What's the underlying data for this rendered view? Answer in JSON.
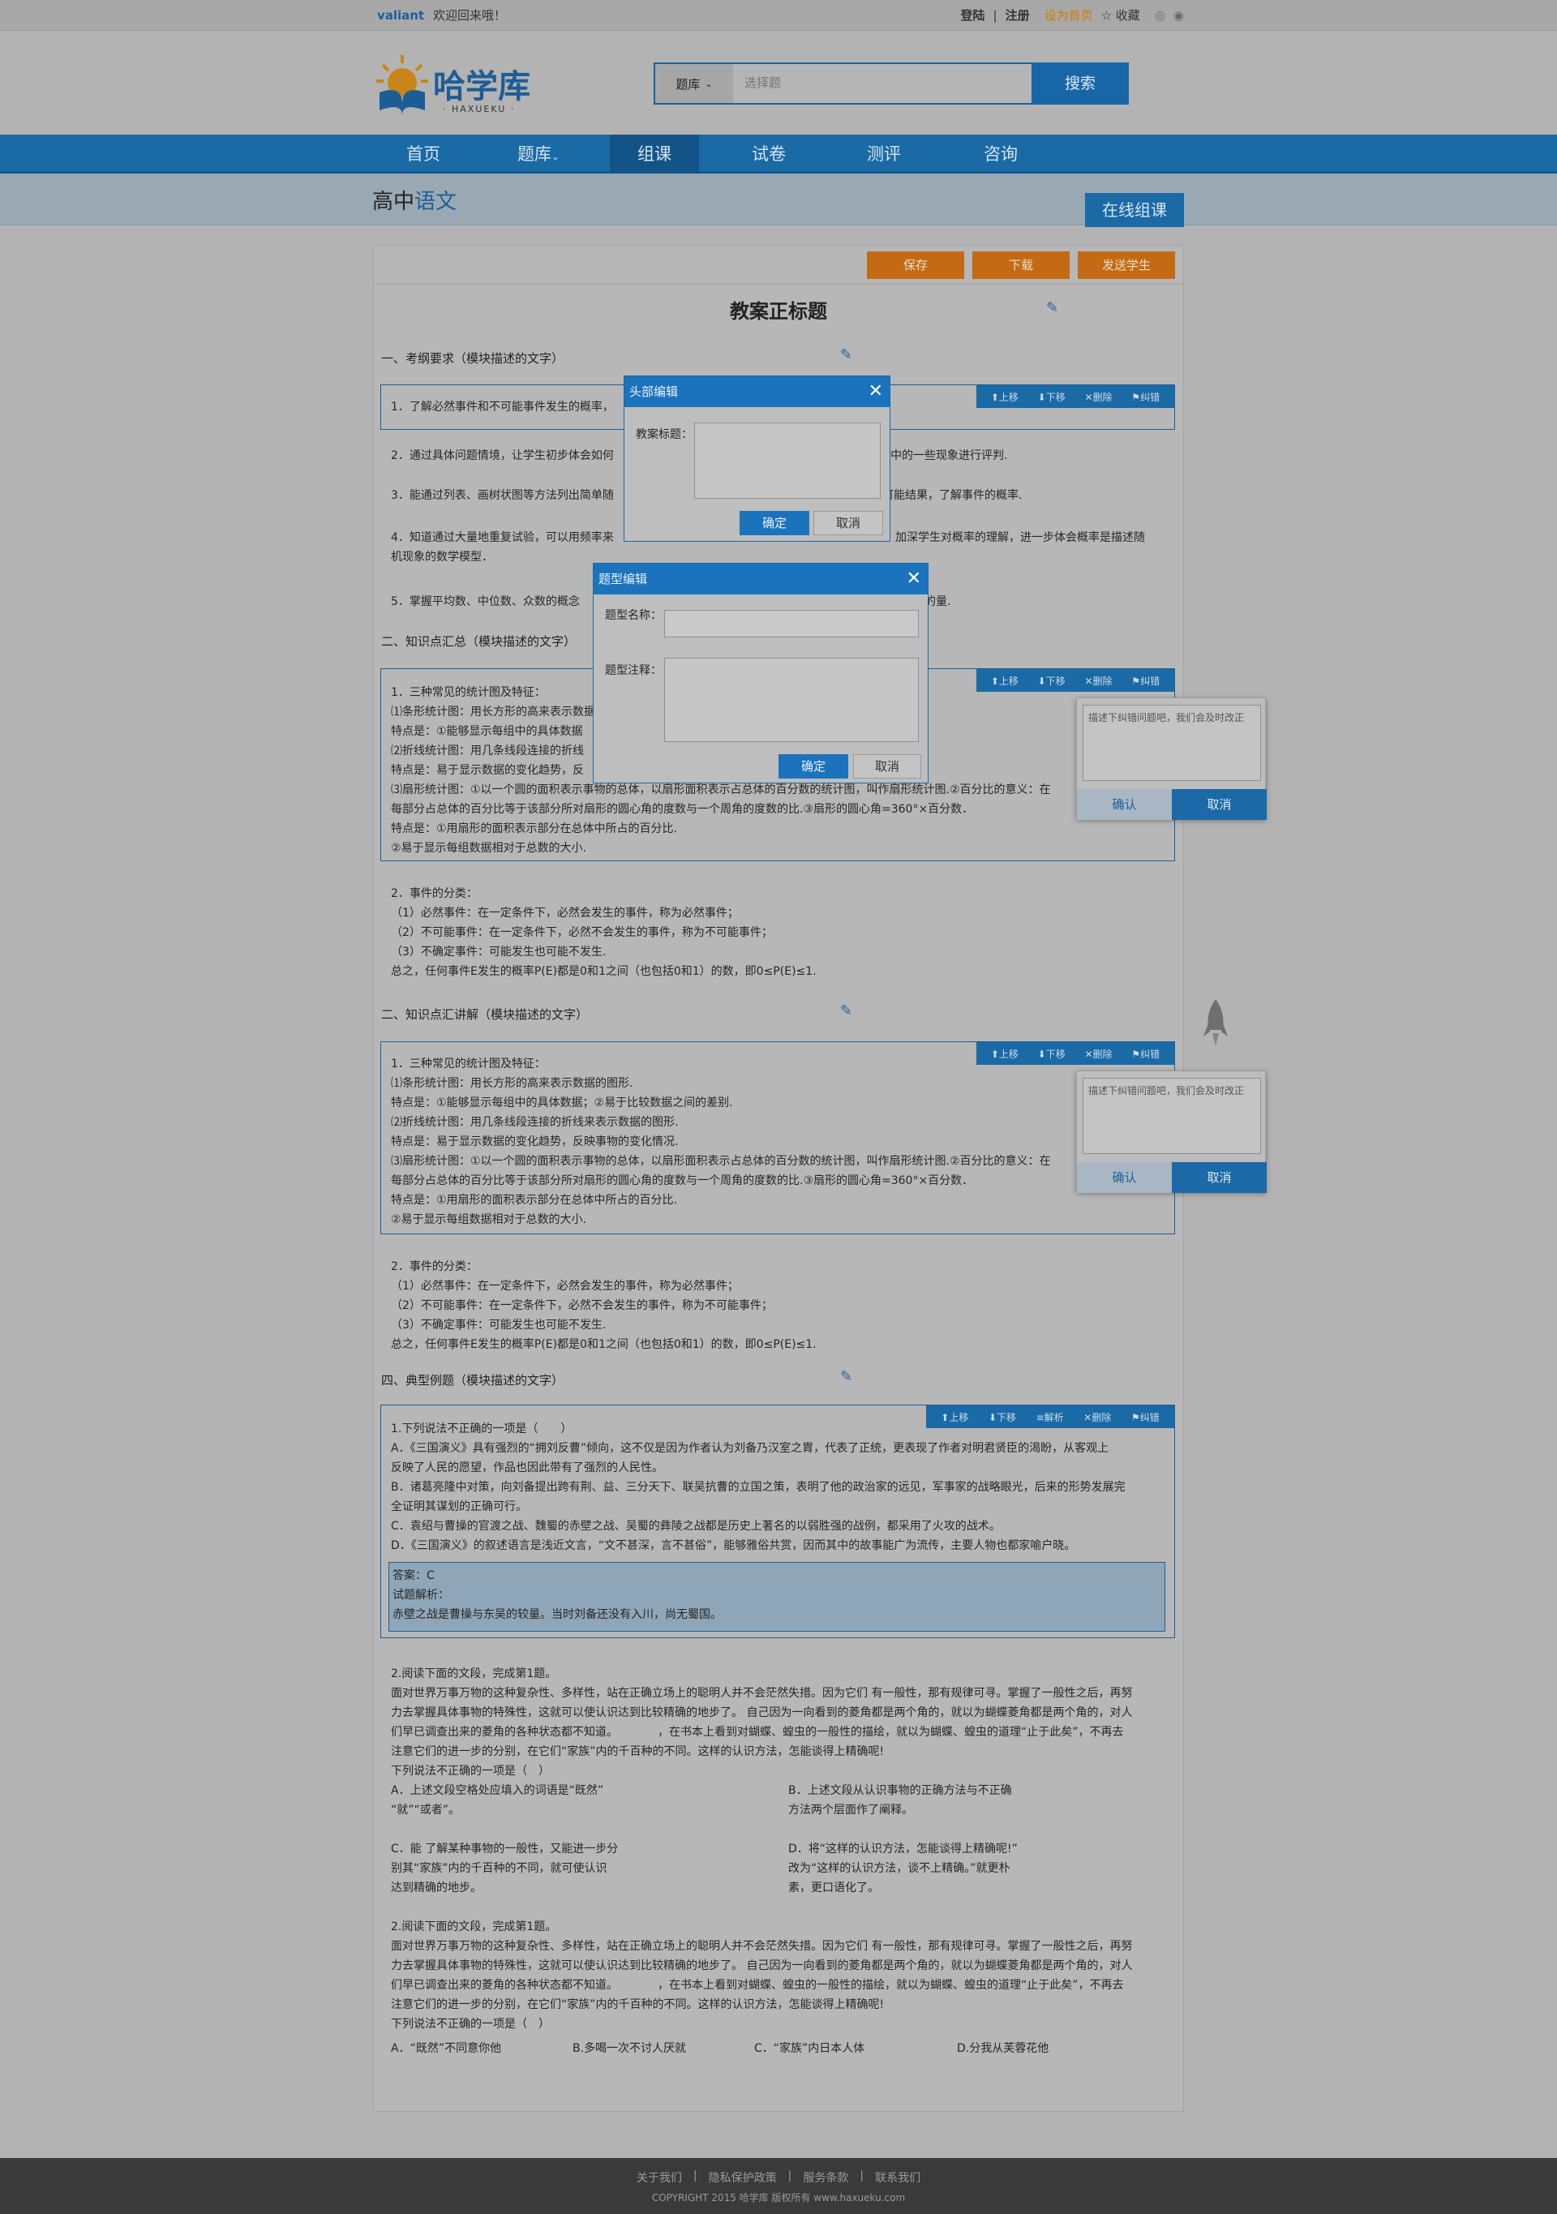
{
  "topbar": {
    "brand": "valiant",
    "welcome": "欢迎回来哦！",
    "login": "登陆",
    "sep": "|",
    "register": "注册",
    "set_home": "设为首页",
    "favorite": "☆ 收藏"
  },
  "logo": {
    "cn": "哈学库",
    "en": "· HAXUEKU ·"
  },
  "search": {
    "category": "题库",
    "placeholder": "选择题",
    "button": "搜索"
  },
  "nav": [
    "首页",
    "题库",
    "组课",
    "试卷",
    "测评",
    "咨询"
  ],
  "crumb": {
    "level": "高中",
    "subject": "语文"
  },
  "online_button": "在线组课",
  "actions": {
    "save": "保存",
    "download": "下载",
    "send": "发送学生"
  },
  "doc_title": "教案正标题",
  "tools": {
    "up": "上移",
    "down": "下移",
    "delete": "删除",
    "report": "纠错",
    "analysis": "解析"
  },
  "sections": {
    "s1": "一、考纲要求（模块描述的文字）",
    "s2": "二、知识点汇总（模块描述的文字）",
    "s3": "二、知识点汇讲解（模块描述的文字）",
    "s4": "四、典型例题（模块描述的文字）"
  },
  "req": [
    "1．了解必然事件和不可能事件发生的概率，",
    "2．通过具体问题情境，让学生初步体会如何",
    "中的一些现象进行评判.",
    "3．能通过列表、画树状图等方法列出简单随",
    "可能结果，了解事件的概率.",
    "4．知道通过大量地重复试验，可以用频率来",
    "，加深学生对概率的理解，进一步体会概率是描述随",
    "机现象的数学模型．",
    "5．掌握平均数、中位数、众数的概念",
    "中趋势的量."
  ],
  "kp1": [
    "1．三种常见的统计图及特征：",
    "⑴条形统计图：用长方形的高来表示数据",
    "特点是：①能够显示每组中的具体数据",
    "⑵折线统计图：用几条线段连接的折线",
    "特点是：易于显示数据的变化趋势，反",
    "⑶扇形统计图：①以一个圆的面积表示事物的总体，以扇形面积表示占总体的百分数的统计图，叫作扇形统计图.②百分比的意义：在",
    "每部分占总体的百分比等于该部分所对扇形的圆心角的度数与一个周角的度数的比.③扇形的圆心角=360°×百分数．",
    "特点是：①用扇形的面积表示部分在总体中所占的百分比.",
    "②易于显示每组数据相对于总数的大小."
  ],
  "events": [
    "2．事件的分类：",
    "（1）必然事件：在一定条件下，必然会发生的事件，称为必然事件；",
    "（2）不可能事件：在一定条件下，必然不会发生的事件，称为不可能事件；",
    "（3）不确定事件：可能发生也可能不发生.",
    "总之，任何事件E发生的概率P(E)都是0和1之间（也包括0和1）的数，即0≤P(E)≤1."
  ],
  "kp2": [
    "1．三种常见的统计图及特征：",
    "⑴条形统计图：用长方形的高来表示数据的图形.",
    "特点是：①能够显示每组中的具体数据；②易于比较数据之间的差别.",
    "⑵折线统计图：用几条线段连接的折线来表示数据的图形.",
    "特点是：易于显示数据的变化趋势，反映事物的变化情况.",
    "⑶扇形统计图：①以一个圆的面积表示事物的总体，以扇形面积表示占总体的百分数的统计图，叫作扇形统计图.②百分比的意义：在",
    "每部分占总体的百分比等于该部分所对扇形的圆心角的度数与一个周角的度数的比.③扇形的圆心角=360°×百分数．",
    "特点是：①用扇形的面积表示部分在总体中所占的百分比.",
    "②易于显示每组数据相对于总数的大小."
  ],
  "q1": [
    "1.下列说法不正确的一项是（　　）",
    "A．《三国演义》具有强烈的“拥刘反曹”倾向，这不仅是因为作者认为刘备乃汉室之胄，代表了正统，更表现了作者对明君贤臣的渴盼，从客观上",
    "反映了人民的愿望，作品也因此带有了强烈的人民性。",
    "B．诸葛亮隆中对策，向刘备提出跨有荆、益、三分天下、联吴抗曹的立国之策，表明了他的政治家的远见，军事家的战略眼光，后来的形势发展完",
    "全证明其谋划的正确可行。",
    "C．袁绍与曹操的官渡之战、魏蜀的赤壁之战、吴蜀的彝陵之战都是历史上著名的以弱胜强的战例，都采用了火攻的战术。",
    "D．《三国演义》的叙述语言是浅近文言，“文不甚深，言不甚俗”，能够雅俗共赏，因而其中的故事能广为流传，主要人物也都家喻户晓。"
  ],
  "ans": [
    "答案：C",
    "试题解析：",
    "赤壁之战是曹操与东吴的较量。当时刘备还没有入川，尚无蜀国。"
  ],
  "q2": [
    "2.阅读下面的文段，完成第1题。",
    "面对世界万事万物的这种复杂性、多样性，站在正确立场上的聪明人并不会茫然失措。因为它们 有一般性，那有规律可寻。掌握了一般性之后，再努",
    "力去掌握具体事物的特殊性，这就可以使认识达到比较精确的地步了。 自己因为一向看到的菱角都是两个角的，就以为蝴蝶菱角都是两个角的，对人",
    "们早已调查出来的菱角的各种状态都不知道。　　　　，在书本上看到对蝴蝶、蝗虫的一般性的描绘，就以为蝴蝶、蝗虫的道理“止于此矣”，不再去",
    "注意它们的进一步的分别，在它们“家族”内的千百种的不同。这样的认识方法，怎能谈得上精确呢!",
    "下列说法不正确的一项是（　）"
  ],
  "q2opts": [
    "A．上述文段空格处应填入的词语是“既然”",
    "“就”“或者”。",
    "B．上述文段从认识事物的正确方法与不正确",
    "方法两个层面作了阐释。",
    "C．能 了解某种事物的一般性，又能进一步分",
    "别其“家族”内的千百种的不同，就可使认识",
    "达到精确的地步。",
    "D．将“这样的认识方法，怎能谈得上精确呢!”",
    "改为“这样的认识方法，谈不上精确。”就更朴",
    "素，更口语化了。"
  ],
  "q3opts": [
    "A．“既然”不同意你他",
    "B.多喝一次不讨人厌就",
    "C．“家族”内日本人体",
    "D.分我从芙蓉花他"
  ],
  "modal1": {
    "title": "头部编辑",
    "label": "教案标题：",
    "ok": "确定",
    "cancel": "取消"
  },
  "modal2": {
    "title": "题型编辑",
    "name_label": "题型名称：",
    "note_label": "题型注释：",
    "ok": "确定",
    "cancel": "取消"
  },
  "report": {
    "placeholder": "描述下纠错问题吧，我们会及时改正",
    "ok": "确认",
    "cancel": "取消"
  },
  "footer": {
    "links": [
      "关于我们",
      "隐私保护政策",
      "服务条款",
      "联系我们"
    ],
    "sep": "|",
    "copy": "COPYRIGHT 2015  哈学库  版权所有   www.haxueku.com"
  }
}
